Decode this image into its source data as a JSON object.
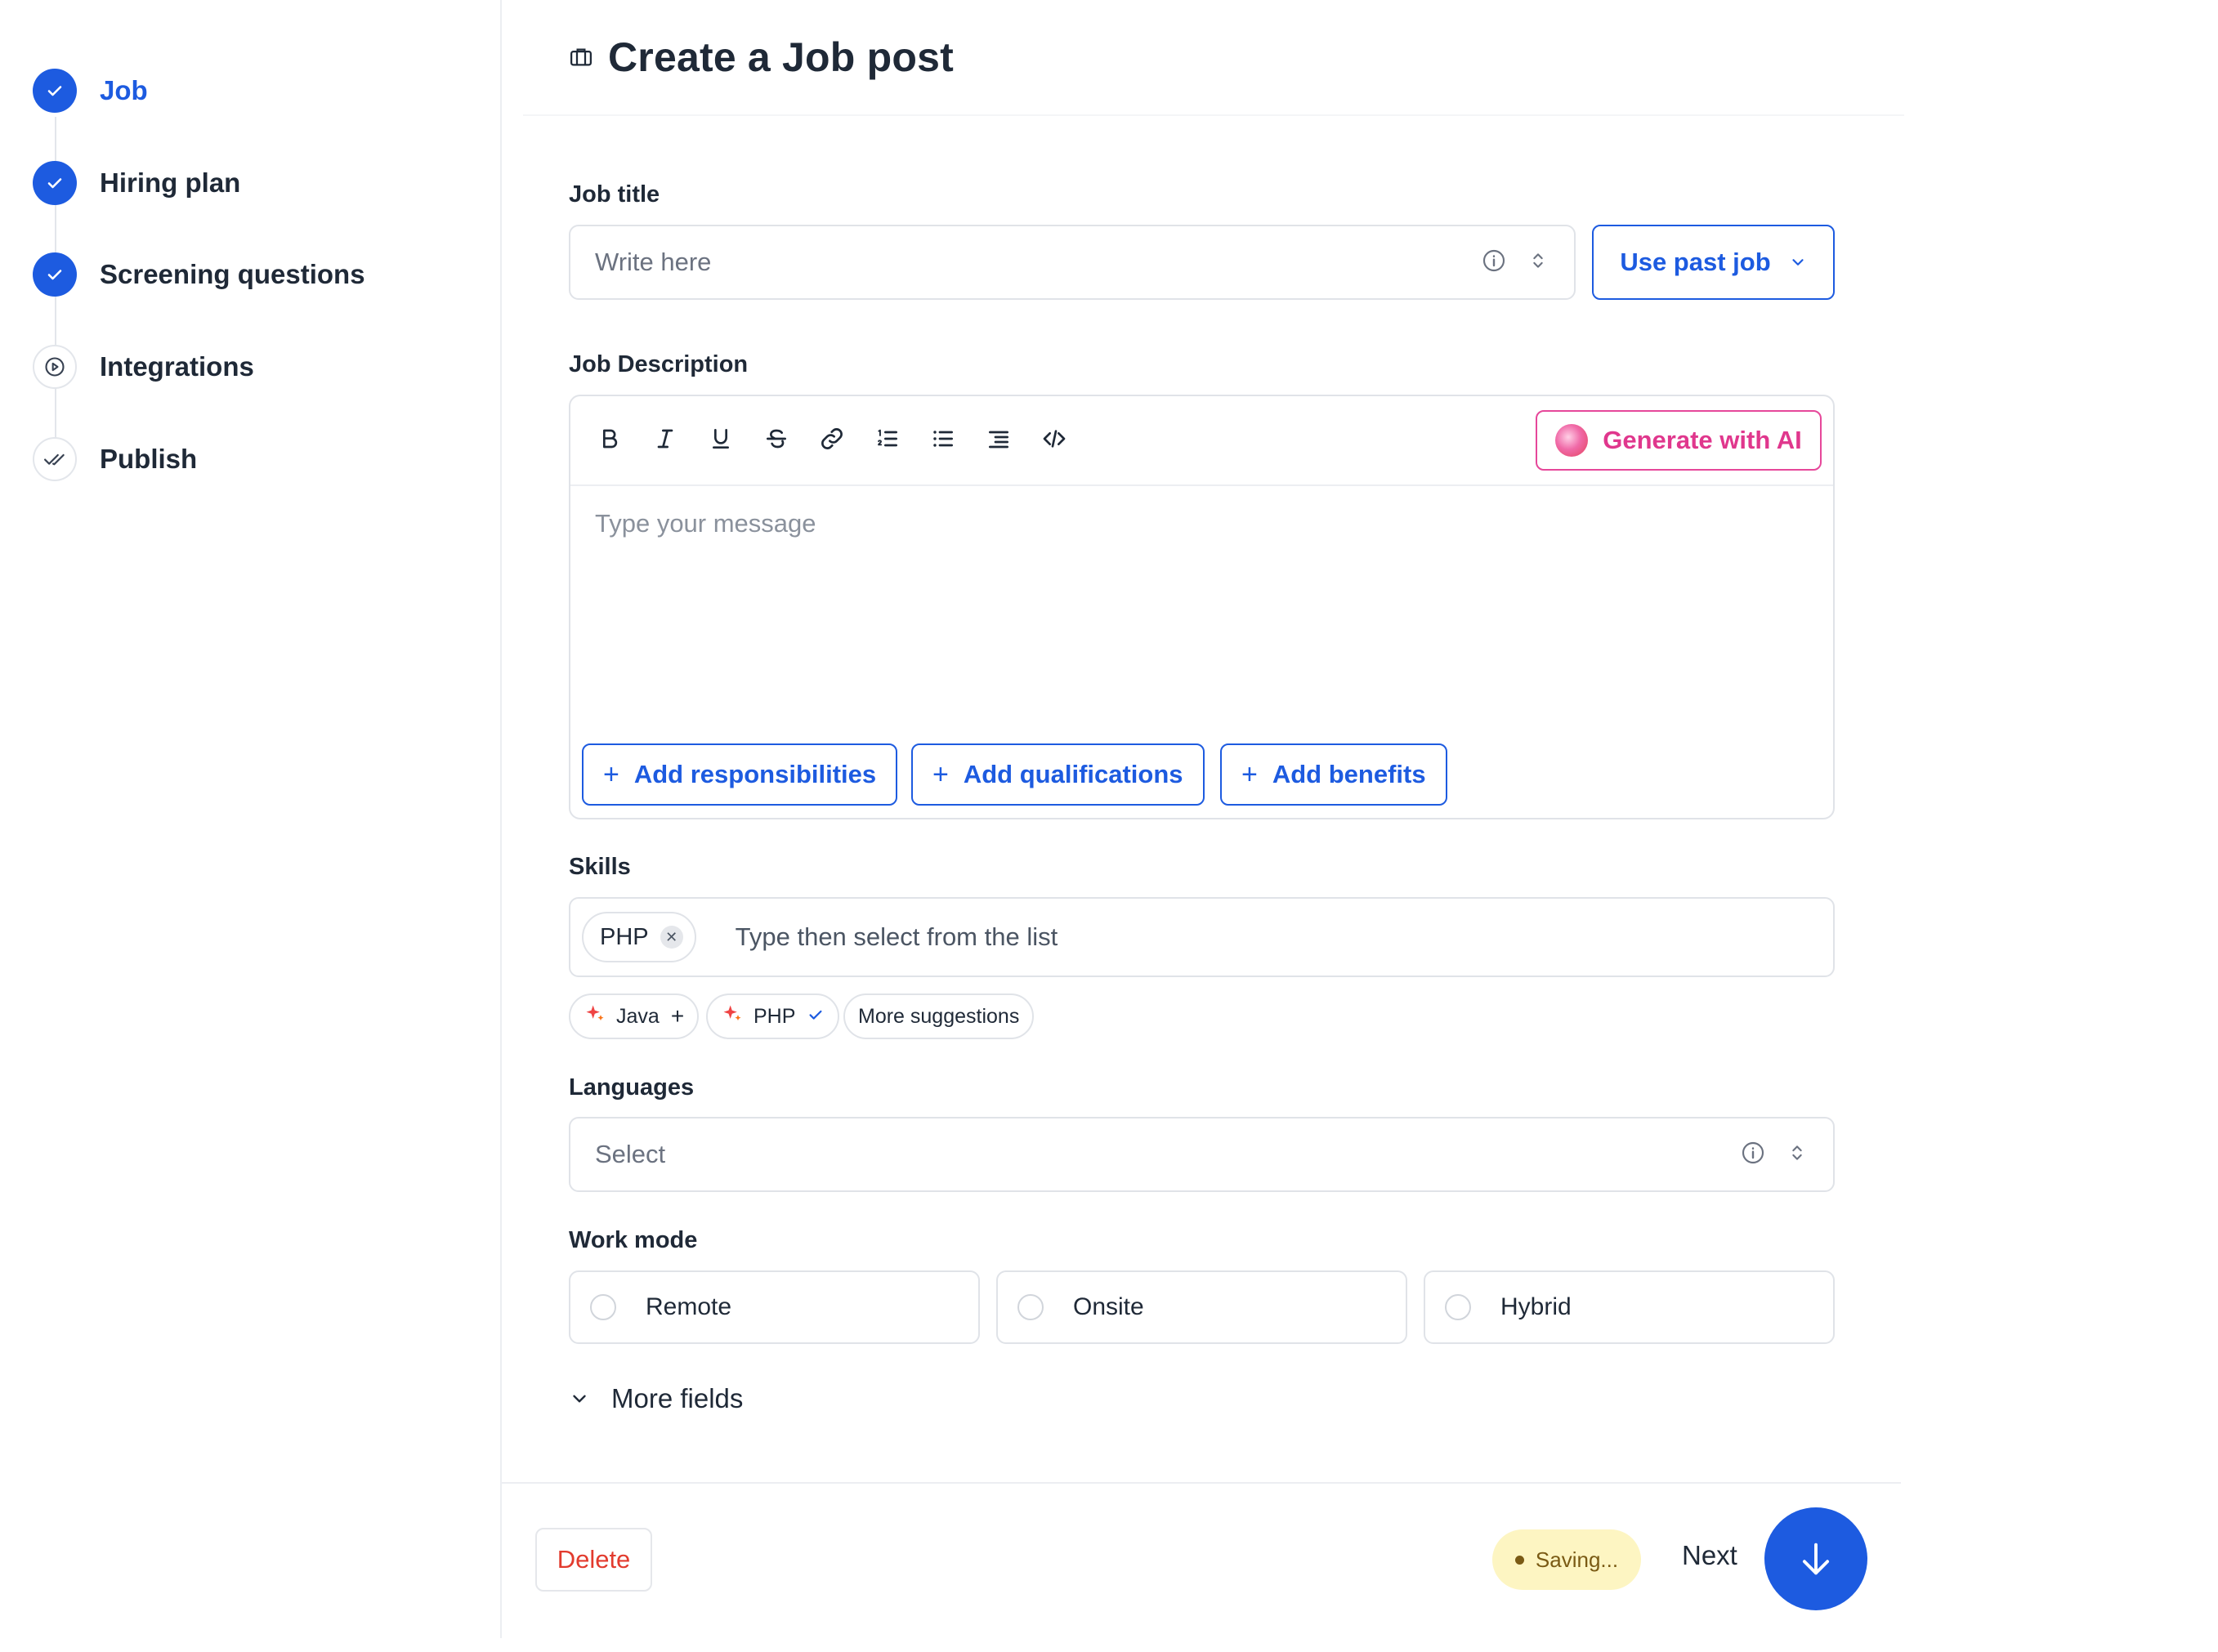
{
  "steps": [
    {
      "label": "Job",
      "state": "done",
      "active": true
    },
    {
      "label": "Hiring plan",
      "state": "done"
    },
    {
      "label": "Screening questions",
      "state": "done"
    },
    {
      "label": "Integrations",
      "state": "pending",
      "icon": "play-circle-icon"
    },
    {
      "label": "Publish",
      "state": "pending",
      "icon": "double-check-icon"
    }
  ],
  "header": {
    "title": "Create a Job post",
    "icon": "briefcase-icon"
  },
  "job_title": {
    "label": "Job title",
    "placeholder": "Write here",
    "use_past_job": "Use past job"
  },
  "description": {
    "label": "Job Description",
    "toolbar": [
      "bold-icon",
      "italic-icon",
      "underline-icon",
      "strikethrough-icon",
      "link-icon",
      "ordered-list-icon",
      "bullet-list-icon",
      "indent-icon",
      "code-icon"
    ],
    "generate_ai": "Generate with AI",
    "placeholder": "Type your message",
    "add_buttons": {
      "responsibilities": "Add responsibilities",
      "qualifications": "Add qualifications",
      "benefits": "Add benefits"
    },
    "plus": "+"
  },
  "skills": {
    "label": "Skills",
    "selected": [
      {
        "name": "PHP"
      }
    ],
    "placeholder": "Type then select from the list",
    "suggestions": [
      {
        "name": "Java",
        "status": "add"
      },
      {
        "name": "PHP",
        "status": "added"
      }
    ],
    "more_suggestions": "More suggestions"
  },
  "languages": {
    "label": "Languages",
    "placeholder": "Select"
  },
  "work_mode": {
    "label": "Work mode",
    "options": [
      "Remote",
      "Onsite",
      "Hybrid"
    ]
  },
  "more_fields": "More fields",
  "footer": {
    "delete": "Delete",
    "saving": "Saving...",
    "next": "Next"
  },
  "colors": {
    "primary": "#1d5be0",
    "ai_accent": "#e0378d",
    "danger": "#e23b2e",
    "saving_bg": "#fdf5c2"
  }
}
